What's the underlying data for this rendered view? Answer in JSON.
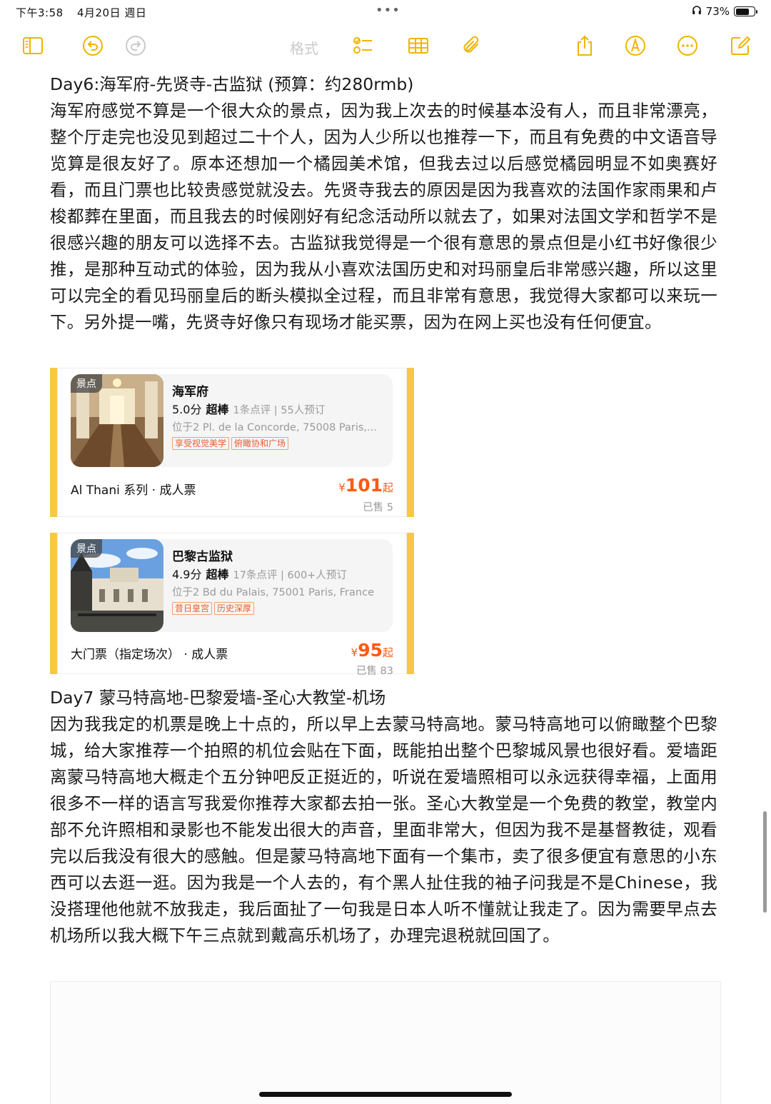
{
  "status_bar": {
    "time": "下午3:58",
    "date": "4月20日 週日",
    "dots": "•••",
    "battery": "73%",
    "battery_level": 0.73
  },
  "toolbar": {
    "format_label": "格式",
    "icons": [
      "sidebar-icon",
      "undo-icon",
      "redo-icon",
      "checklist-icon",
      "table-icon",
      "attachment-icon",
      "share-icon",
      "markup-icon",
      "more-icon",
      "compose-icon"
    ]
  },
  "note": {
    "day6_title": "Day6:海军府-先贤寺-古监狱 (预算：约280rmb)",
    "day6_body": "海军府感觉不算是一个很大众的景点，因为我上次去的时候基本没有人，而且非常漂亮，整个厅走完也没见到超过二十个人，因为人少所以也推荐一下，而且有免费的中文语音导览算是很友好了。原本还想加一个橘园美术馆，但我去过以后感觉橘园明显不如奥赛好看，而且门票也比较贵感觉就没去。先贤寺我去的原因是因为我喜欢的法国作家雨果和卢梭都葬在里面，而且我去的时候刚好有纪念活动所以就去了，如果对法国文学和哲学不是很感兴趣的朋友可以选择不去。古监狱我觉得是一个很有意思的景点但是小红书好像很少推，是那种互动式的体验，因为我从小喜欢法国历史和对玛丽皇后非常感兴趣，所以这里可以完全的看见玛丽皇后的断头模拟全过程，而且非常有意思，我觉得大家都可以来玩一下。另外提一嘴，先贤寺好像只有现场才能买票，因为在网上买也没有任何便宜。",
    "day7_title": "Day7 蒙马特高地-巴黎爱墙-圣心大教堂-机场",
    "day7_body": "因为我我定的机票是晚上十点的，所以早上去蒙马特高地。蒙马特高地可以俯瞰整个巴黎城，给大家推荐一个拍照的机位会贴在下面，既能拍出整个巴黎城风景也很好看。爱墙距离蒙马特高地大概走个五分钟吧反正挺近的，听说在爱墙照相可以永远获得幸福，上面用很多不一样的语言写我爱你推荐大家都去拍一张。圣心大教堂是一个免费的教堂，教堂内部不允许照相和录影也不能发出很大的声音，里面非常大，但因为我不是基督教徒，观看完以后我没有很大的感触。但是蒙马特高地下面有一个集市，卖了很多便宜有意思的小东西可以去逛一逛。因为我是一个人去的，有个黑人扯住我的袖子问我是不是Chinese，我没搭理他他就不放我走，我后面扯了一句我是日本人听不懂就让我走了。因为需要早点去机场所以我大概下午三点就到戴高乐机场了，办理完退税就回国了。"
  },
  "cards": [
    {
      "tag": "景点",
      "title": "海军府",
      "score": "5.0分",
      "super": "超棒",
      "reviews": "1条点评 | 55人预订",
      "address": "位于2 Pl. de la Concorde, 75008 Paris,...",
      "tags": [
        "享受视觉美学",
        "俯瞰协和广场"
      ],
      "ticket": "Al Thani 系列 · 成人票",
      "currency": "¥",
      "price": "101",
      "price_suffix": "起",
      "sold": "已售 5"
    },
    {
      "tag": "景点",
      "title": "巴黎古监狱",
      "score": "4.9分",
      "super": "超棒",
      "reviews": "17条点评 | 600+人预订",
      "address": "位于2 Bd du Palais, 75001 Paris, France",
      "tags": [
        "昔日皇宫",
        "历史深厚"
      ],
      "ticket": "大门票（指定场次） · 成人票",
      "currency": "¥",
      "price": "95",
      "price_suffix": "起",
      "sold": "已售 83"
    }
  ],
  "colors": {
    "accent_yellow": "#f7c843",
    "price_orange": "#ff5a0e",
    "toolbar_yellow": "#f0b400"
  }
}
